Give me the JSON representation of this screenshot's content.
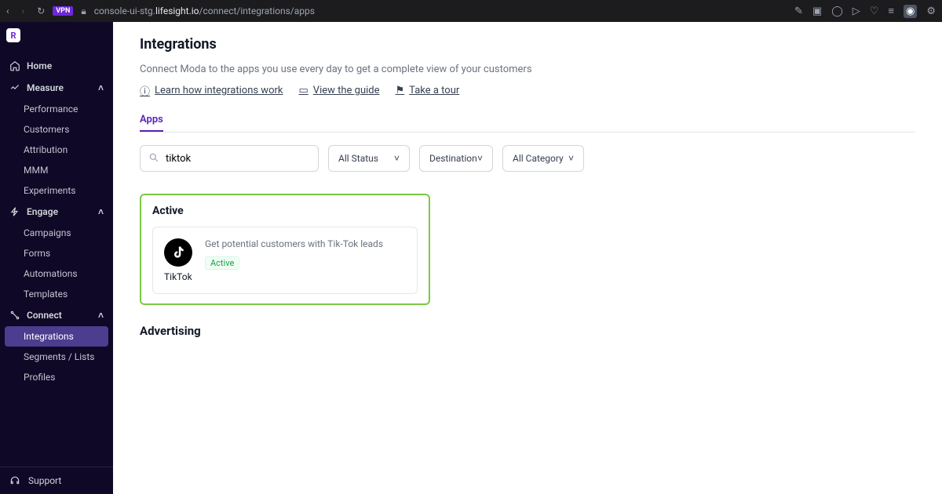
{
  "browser": {
    "url_prefix": "console-ui-stg.",
    "url_domain": "lifesight.io",
    "url_path": "/connect/integrations/apps",
    "vpn": "VPN"
  },
  "sidebar": {
    "logo_letter": "R",
    "home": "Home",
    "measure": {
      "label": "Measure",
      "items": [
        "Performance",
        "Customers",
        "Attribution",
        "MMM",
        "Experiments"
      ]
    },
    "engage": {
      "label": "Engage",
      "items": [
        "Campaigns",
        "Forms",
        "Automations",
        "Templates"
      ]
    },
    "connect": {
      "label": "Connect",
      "items": [
        "Integrations",
        "Segments / Lists",
        "Profiles"
      ]
    },
    "support": "Support"
  },
  "page": {
    "title": "Integrations",
    "subtitle": "Connect Moda to the apps you use every day to get a complete view of your customers",
    "link_learn": "Learn how integrations work",
    "link_guide": "View the guide",
    "link_tour": "Take a tour",
    "tab_apps": "Apps"
  },
  "filters": {
    "search_value": "tiktok",
    "status": "All Status",
    "destination": "Destination",
    "category": "All Category"
  },
  "active_section": {
    "title": "Active",
    "card": {
      "desc": "Get potential customers with Tik-Tok leads",
      "status": "Active",
      "name": "TikTok"
    }
  },
  "advertising_section": {
    "title": "Advertising"
  }
}
